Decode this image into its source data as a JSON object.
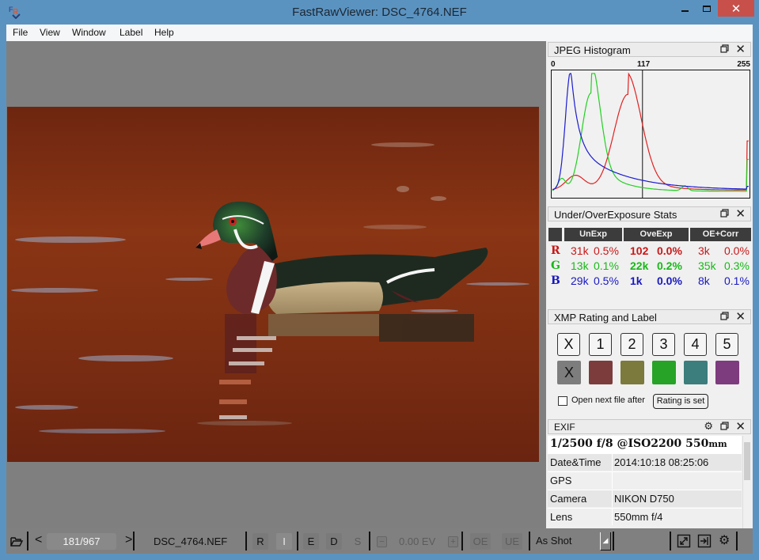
{
  "window": {
    "title": "FastRawViewer: DSC_4764.NEF",
    "controls": {
      "minimize": "minimize",
      "maximize": "maximize",
      "close": "✕"
    }
  },
  "menu": [
    "File",
    "View",
    "Window",
    "Label",
    "Help"
  ],
  "histogram": {
    "title": "JPEG Histogram",
    "scale_min": "0",
    "marker": "117",
    "scale_max": "255",
    "chart_data": {
      "type": "line",
      "title": "JPEG Histogram",
      "x_range": [
        0,
        255
      ],
      "marker_x": 117,
      "series": [
        {
          "name": "R",
          "color": "#e02020",
          "peak_x": 98,
          "shape": "broad peak around 95-100, low shoulder near 35-50, tail to 255 with spike at 255"
        },
        {
          "name": "G",
          "color": "#20d020",
          "peak_x": 50,
          "shape": "peak around 50, small bump near 170, spike at 255"
        },
        {
          "name": "B",
          "color": "#1a1ad0",
          "peak_x": 24,
          "shape": "sharp peak around 24, long decaying tail, spike at 255"
        }
      ]
    }
  },
  "exposure_stats": {
    "title": "Under/OverExposure Stats",
    "headers": [
      "",
      "UnExp",
      "OveExp",
      "OE+Corr"
    ],
    "rows": [
      {
        "channel": "R",
        "color": "#c81818",
        "unexp_count": "31k",
        "unexp_pct": "0.5%",
        "oveexp_count": "102",
        "oveexp_pct": "0.0%",
        "oecorr_count": "3k",
        "oecorr_pct": "0.0%"
      },
      {
        "channel": "G",
        "color": "#18b818",
        "unexp_count": "13k",
        "unexp_pct": "0.1%",
        "oveexp_count": "22k",
        "oveexp_pct": "0.2%",
        "oecorr_count": "35k",
        "oecorr_pct": "0.3%"
      },
      {
        "channel": "B",
        "color": "#1818c0",
        "unexp_count": "29k",
        "unexp_pct": "0.5%",
        "oveexp_count": "1k",
        "oveexp_pct": "0.0%",
        "oecorr_count": "8k",
        "oecorr_pct": "0.1%"
      }
    ]
  },
  "xmp": {
    "title": "XMP Rating and Label",
    "ratings": [
      "X",
      "1",
      "2",
      "3",
      "4",
      "5"
    ],
    "labels": [
      {
        "text": "X",
        "color": "#7d7d7d"
      },
      {
        "text": "",
        "color": "#7d3c3c"
      },
      {
        "text": "",
        "color": "#7c7a3c"
      },
      {
        "text": "",
        "color": "#27a327"
      },
      {
        "text": "",
        "color": "#3c7d7d"
      },
      {
        "text": "",
        "color": "#7d3c7d"
      }
    ],
    "open_next_label": "Open next file after",
    "open_next_checked": false,
    "rating_is_set_label": "Rating is set"
  },
  "exif": {
    "title": "EXIF",
    "summary_main": "1/2500 f/8 @ISO2200 550",
    "summary_unit": "mm",
    "rows": [
      {
        "key": "Date&Time",
        "value": "2014:10:18 08:25:06"
      },
      {
        "key": "GPS",
        "value": ""
      },
      {
        "key": "Camera",
        "value": "NIKON D750"
      },
      {
        "key": "Lens",
        "value": "550mm f/4"
      }
    ]
  },
  "statusbar": {
    "counter": "181/967",
    "filename": "DSC_4764.NEF",
    "btn_r": "R",
    "btn_i": "I",
    "btn_e": "E",
    "btn_d": "D",
    "btn_s": "S",
    "ev_minus": "−",
    "ev_value": "0.00 EV",
    "ev_plus": "+",
    "btn_oe": "OE",
    "btn_ue": "UE",
    "white_balance": "As Shot"
  }
}
